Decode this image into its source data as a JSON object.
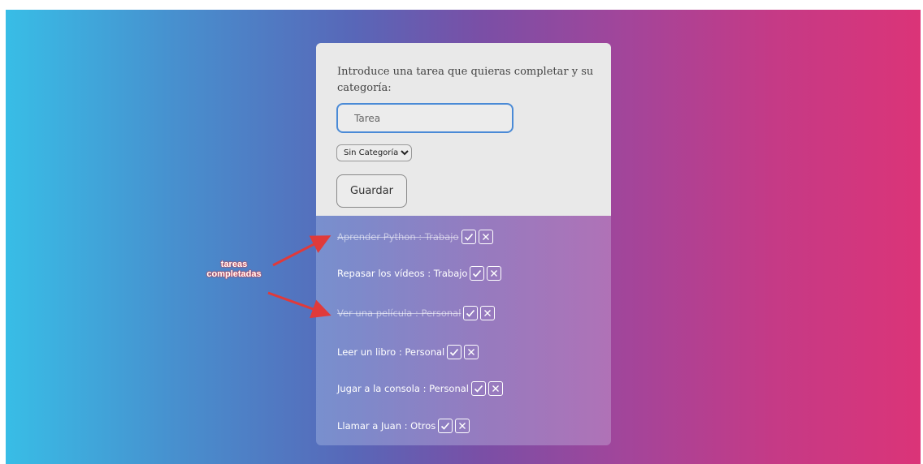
{
  "form": {
    "prompt": "Introduce una tarea que quieras completar y su categoría:",
    "input_placeholder": "Tarea",
    "input_value": "",
    "category_selected": "Sin Categoría",
    "save_label": "Guardar"
  },
  "tasks": [
    {
      "name": "Aprender Python",
      "category": "Trabajo",
      "label": "Aprender Python : Trabajo",
      "completed": true
    },
    {
      "name": "Repasar los vídeos",
      "category": "Trabajo",
      "label": "Repasar los vídeos : Trabajo",
      "completed": false
    },
    {
      "name": "Ver una película",
      "category": "Personal",
      "label": "Ver una película : Personal",
      "completed": true
    },
    {
      "name": "Leer un libro",
      "category": "Personal",
      "label": "Leer un libro : Personal",
      "completed": false
    },
    {
      "name": "Jugar a la consola",
      "category": "Personal",
      "label": "Jugar a la consola : Personal",
      "completed": false
    },
    {
      "name": "Llamar a Juan",
      "category": "Otros",
      "label": "Llamar a Juan : Otros",
      "completed": false
    }
  ],
  "annotation": {
    "line1": "tareas",
    "line2": "completadas",
    "color": "#e03a3a"
  },
  "icons": {
    "complete": "check-icon",
    "delete": "close-icon"
  },
  "colors": {
    "gradient_left": "#38bde6",
    "gradient_right": "#db3478",
    "input_border": "#4a8ad6"
  }
}
